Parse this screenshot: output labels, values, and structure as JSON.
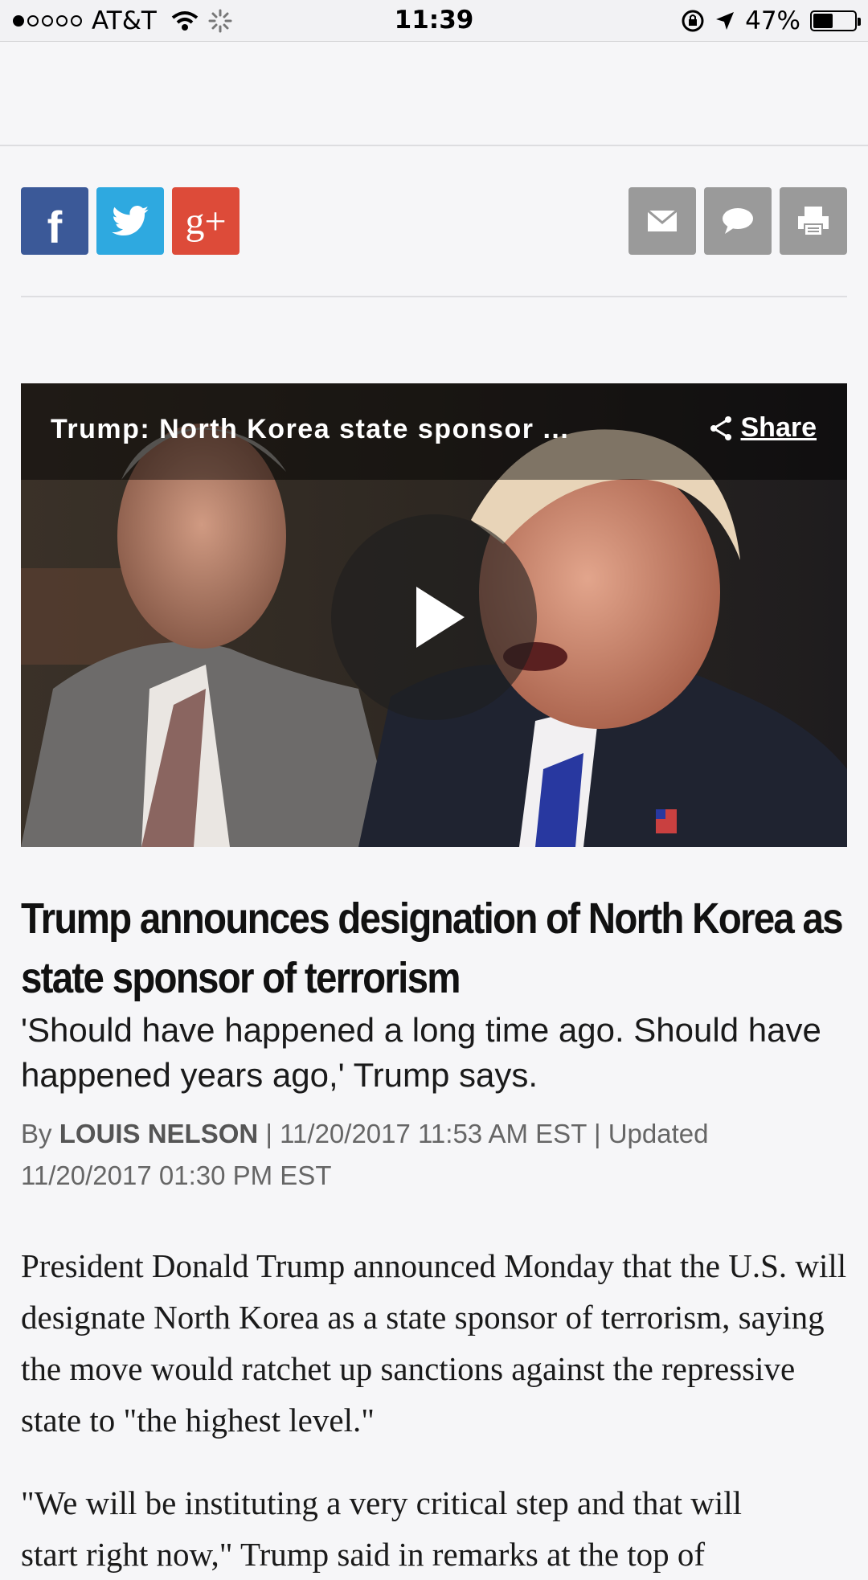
{
  "status_bar": {
    "carrier": "AT&T",
    "time": "11:39",
    "battery": "47%",
    "battery_level": 0.47,
    "signal_bars_filled": 1,
    "signal_bars_total": 5
  },
  "share_bar": {
    "facebook_label": "f",
    "googleplus_label": "g+",
    "colors": {
      "facebook": "#3b5998",
      "twitter": "#2ea9e0",
      "googleplus": "#dd4b39",
      "utility": "#9a9a9a"
    }
  },
  "video": {
    "title": "Trump: North Korea state sponsor ...",
    "share_label": "Share"
  },
  "article": {
    "headline": "Trump announces designation of North Korea as state sponsor of terrorism",
    "dek": "'Should have happened a long time ago. Should have happened years ago,' Trump says.",
    "byline_prefix": "By",
    "author": "LOUIS NELSON",
    "published": "11/20/2017 11:53 AM EST",
    "updated_prefix": "Updated",
    "updated": "11/20/2017 01:30 PM EST",
    "paragraphs": [
      "President Donald Trump announced Monday that the U.S. will designate North Korea as a state sponsor of terrorism, saying the move would ratchet up sanctions against the repressive state to \"the highest level.\"",
      "\"We will be instituting a very critical step and that will start right now,\" Trump said in remarks at the top of"
    ]
  }
}
